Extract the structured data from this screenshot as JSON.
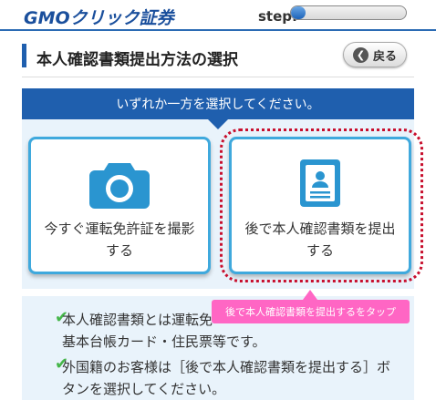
{
  "header": {
    "logo": "GMOクリック証券",
    "step_label": "step:",
    "step_progress": 0.13
  },
  "page": {
    "title": "本人確認書類提出方法の選択",
    "back_label": "戻る"
  },
  "banner": {
    "text": "いずれか一方を選択してください。"
  },
  "options": [
    {
      "line1": "今すぐ運転免許証を撮影",
      "line2": "する",
      "icon": "camera-icon"
    },
    {
      "line1": "後で本人確認書類を提出",
      "line2": "する",
      "icon": "id-card-icon"
    }
  ],
  "tooltip": {
    "text": "後で本人確認書類を提出するをタップ"
  },
  "info": {
    "items": [
      {
        "line1": "本人確認書類とは運転免",
        "line2": "基本台帳カード・住民票等です。"
      },
      {
        "line1": "外国籍のお客様は［後で本人確認書類を提出する］ボ",
        "line2": "タンを選択してください。"
      }
    ]
  },
  "colors": {
    "brand": "#1f5fae",
    "card_border": "#3fa9dd",
    "highlight": "#c8102e",
    "tooltip": "#ff66c4",
    "check": "#45b649"
  }
}
